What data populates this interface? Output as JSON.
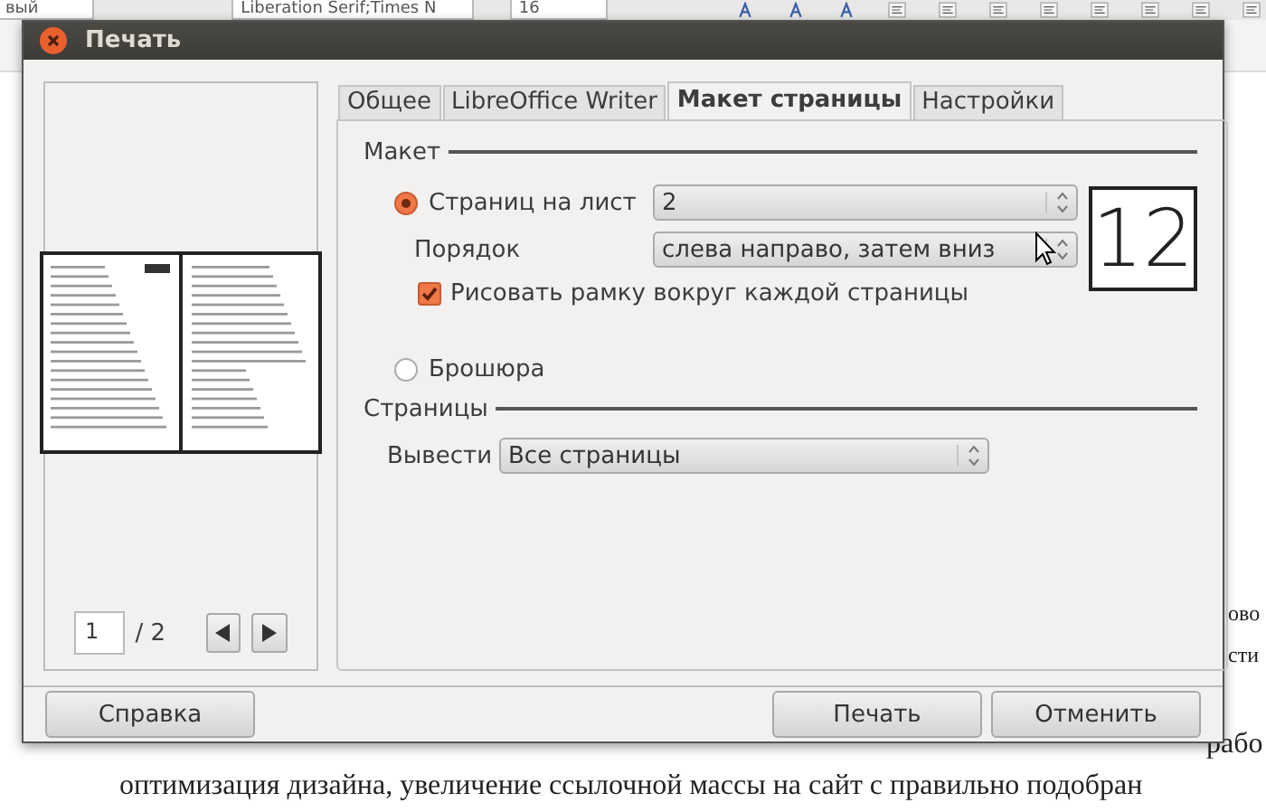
{
  "background": {
    "toolbar": {
      "style_field": "вый",
      "font_field": "Liberation Serif;Times N",
      "size_field": "16"
    },
    "document": {
      "lines": [
        "ово",
        "сти",
        "рабо",
        "оптимизация дизайна, увеличение ссылочной массы на сайт с правильно подобран"
      ]
    }
  },
  "window": {
    "title": "Печать"
  },
  "preview": {
    "page_field": "1",
    "page_count": "/ 2"
  },
  "tabs": [
    {
      "label": "Общее",
      "selected": false
    },
    {
      "label": "LibreOffice Writer",
      "selected": false
    },
    {
      "label": "Макет страницы",
      "selected": true
    },
    {
      "label": "Настройки",
      "selected": false
    }
  ],
  "layout": {
    "title": "Макет",
    "pages_per_sheet": {
      "label": "Страниц на лист",
      "selected": true,
      "value": "2"
    },
    "order": {
      "label": "Порядок",
      "value": "слева направо, затем вниз"
    },
    "draw_border": {
      "label": "Рисовать рамку вокруг каждой страницы",
      "checked": true
    },
    "layout_preview": "12",
    "brochure": {
      "label": "Брошюра",
      "selected": false
    }
  },
  "pages": {
    "title": "Страницы",
    "output": {
      "label": "Вывести",
      "value": "Все страницы"
    }
  },
  "buttons": [
    {
      "label": "Справка",
      "kind": "help"
    },
    {
      "label": "Печать",
      "kind": "action"
    },
    {
      "label": "Отменить",
      "kind": "action"
    }
  ]
}
